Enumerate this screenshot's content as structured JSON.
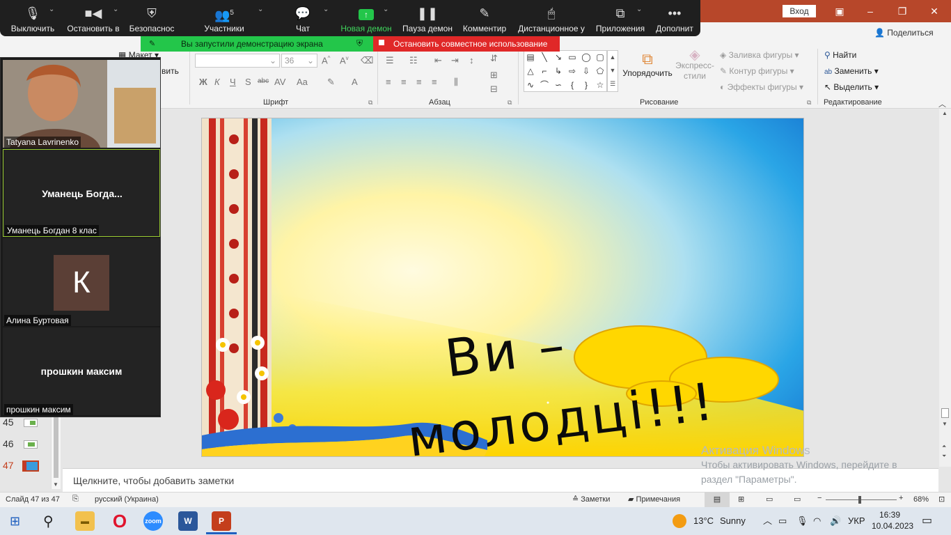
{
  "ppt": {
    "login_label": "Вход",
    "share_label": "Поделиться",
    "window_controls": {
      "restore_icon": "restore-icon",
      "minimize": "–",
      "maximize": "❐",
      "close": "✕"
    },
    "ribbon": {
      "slides_group": {
        "layout_label": "Макет",
        "restore_label": "вить"
      },
      "font_group": {
        "label": "Шрифт",
        "font_size": "36",
        "format_buttons": [
          "Ж",
          "К",
          "Ч",
          "S",
          "abc",
          "AV",
          "Aa",
          "A"
        ]
      },
      "paragraph_group": {
        "label": "Абзац"
      },
      "drawing_group": {
        "label": "Рисование",
        "arrange_label": "Упорядочить",
        "quick_styles_label": "Экспресс-стили",
        "fill_label": "Заливка фигуры",
        "outline_label": "Контур фигуры",
        "effects_label": "Эффекты фигуры"
      },
      "editing_group": {
        "label": "Редактирование",
        "find_label": "Найти",
        "replace_label": "Заменить",
        "select_label": "Выделить"
      }
    },
    "thumbnails": [
      {
        "number": "45",
        "current": false
      },
      {
        "number": "46",
        "current": false
      },
      {
        "number": "47",
        "current": true
      }
    ],
    "slide": {
      "line1": "Ви –",
      "line2": "молодці!!!"
    },
    "notes_placeholder": "Щелкните, чтобы добавить заметки",
    "status": {
      "slide_counter": "Слайд 47 из 47",
      "language": "русский (Украина)",
      "notes_label": "Заметки",
      "comments_label": "Примечания",
      "zoom_level": "68%",
      "zoom_fraction": 0.46
    },
    "activation": {
      "title": "Активация Windows",
      "line1": "Чтобы активировать Windows, перейдите в",
      "line2": "раздел \"Параметры\"."
    }
  },
  "zoom": {
    "toolbar": [
      {
        "label": "Выключить",
        "icon": "microphone-icon"
      },
      {
        "label": "Остановить в",
        "icon": "video-camera-icon"
      },
      {
        "label": "Безопаснос",
        "icon": "shield-icon"
      },
      {
        "label": "Участники",
        "icon": "participants-icon",
        "count": "5"
      },
      {
        "label": "Чат",
        "icon": "chat-icon"
      },
      {
        "label": "Новая демон",
        "icon": "share-screen-icon"
      },
      {
        "label": "Пауза демон",
        "icon": "pause-icon"
      },
      {
        "label": "Комментир",
        "icon": "annotate-icon"
      },
      {
        "label": "Дистанционное у",
        "icon": "remote-control-icon"
      },
      {
        "label": "Приложения",
        "icon": "apps-icon"
      },
      {
        "label": "Дополнит",
        "icon": "more-icon"
      }
    ],
    "share_notice": "Вы запустили демонстрацию экрана",
    "stop_share_label": "Остановить совместное использование",
    "participants": [
      {
        "name": "Tatyana Lavrinenko",
        "display": ""
      },
      {
        "name": "Уманець Богдан 8 клас",
        "display": "Уманець  Богда..."
      },
      {
        "name": "Алина Буртовая",
        "avatar_letter": "К",
        "avatar_color": "#5b3f36"
      },
      {
        "name": "прошкин максим",
        "display": "прошкин максим"
      }
    ]
  },
  "taskbar": {
    "apps": [
      "Проводник",
      "Opera",
      "zoom",
      "Word",
      "PowerPoint"
    ],
    "weather_temp": "13°C",
    "weather_desc": "Sunny",
    "keyboard_lang": "УКР",
    "time": "16:39",
    "date": "10.04.2023"
  },
  "colors": {
    "ppt_accent": "#b7472a",
    "zoom_green": "#23c64a",
    "zoom_red": "#e02828",
    "zoom_toolbar": "#1f1f1f"
  }
}
